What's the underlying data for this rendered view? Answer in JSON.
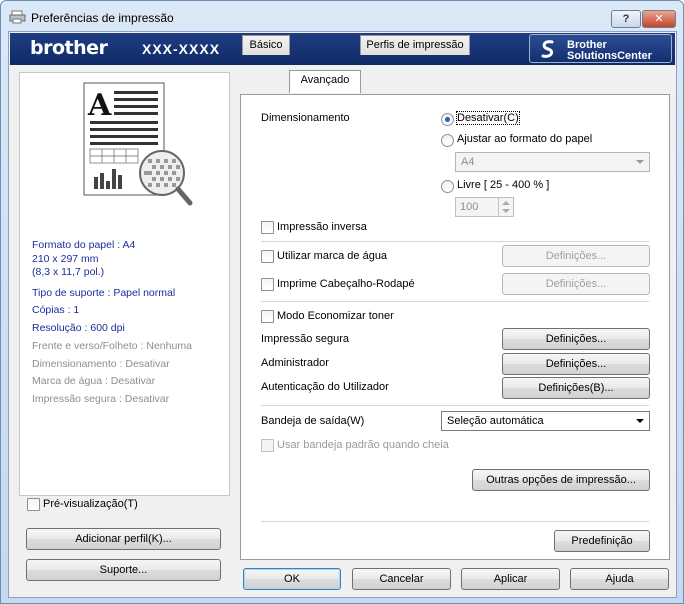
{
  "window": {
    "title": "Preferências de impressão",
    "help_label": "?",
    "close_label": "✕"
  },
  "banner": {
    "brand": "brother",
    "model": "XXX-XXXX",
    "solutions_line1": "Brother",
    "solutions_line2": "SolutionsCenter"
  },
  "summary": {
    "items": [
      "Formato do papel : A4",
      "210 x 297 mm",
      "(8,3 x 11,7 pol.)",
      "Tipo de suporte : Papel normal",
      "Cópias : 1",
      "Resolução : 600 dpi",
      "Frente e verso/Folheto : Nenhuma",
      "Dimensionamento : Desativar",
      "Marca de água : Desativar",
      "Impressão segura : Desativar"
    ],
    "preview_label": "Pré-visualização(T)",
    "add_profile_label": "Adicionar perfil(K)...",
    "support_label": "Suporte..."
  },
  "tabs": [
    "Básico",
    "Avançado",
    "Perfis de impressão"
  ],
  "advanced": {
    "scaling_label": "Dimensionamento",
    "scaling_off": "Desativar(C)",
    "scaling_fit": "Ajustar ao formato do papel",
    "paper_size": "A4",
    "scaling_free": "Livre [ 25 - 400 % ]",
    "free_value": "100",
    "reverse_print": "Impressão inversa",
    "watermark": "Utilizar marca de água",
    "header_footer": "Imprime Cabeçalho-Rodapé",
    "settings_label": "Definições...",
    "settings_b_label": "Definições(B)...",
    "toner_save": "Modo Economizar toner",
    "secure_print": "Impressão segura",
    "administrator": "Administrador",
    "user_auth": "Autenticação do Utilizador",
    "output_tray_label": "Bandeja de saída(W)",
    "output_tray_value": "Seleção automática",
    "use_default_tray": "Usar bandeja padrão quando cheia",
    "other_options": "Outras opções de impressão...",
    "default_label": "Predefinição"
  },
  "footer": {
    "ok": "OK",
    "cancel": "Cancelar",
    "apply": "Aplicar",
    "help": "Ajuda"
  },
  "colors": {
    "banner": "#13306d",
    "summary_text": "#1a2e9c",
    "radio_dot": "#2b5fbb"
  }
}
